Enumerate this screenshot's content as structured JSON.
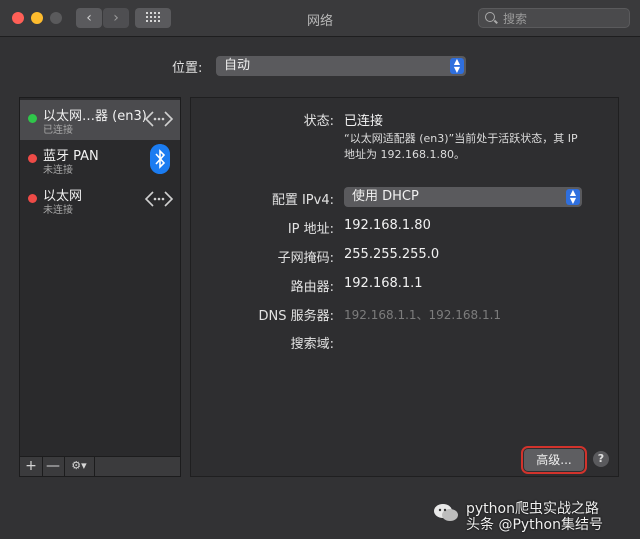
{
  "window": {
    "title": "网络",
    "search_placeholder": "搜索"
  },
  "location": {
    "label": "位置:",
    "value": "自动"
  },
  "services": [
    {
      "name": "以太网…器 (en3)",
      "status": "已连接",
      "state_color": "#2fc64a",
      "icon": "ethernet-arrows-icon"
    },
    {
      "name": "蓝牙 PAN",
      "status": "未连接",
      "state_color": "#ee4b47",
      "icon": "bluetooth-icon"
    },
    {
      "name": "以太网",
      "status": "未连接",
      "state_color": "#ee4b47",
      "icon": "ethernet-arrows-icon"
    }
  ],
  "sidebar_controls": {
    "add": "+",
    "remove": "—",
    "action": "⚙▾"
  },
  "details": {
    "status_label": "状态:",
    "status_value": "已连接",
    "status_desc": "“以太网适配器 (en3)”当前处于活跃状态，其 IP 地址为 192.168.1.80。",
    "ipv4_label": "配置 IPv4:",
    "ipv4_value": "使用 DHCP",
    "ip_label": "IP 地址:",
    "ip_value": "192.168.1.80",
    "mask_label": "子网掩码:",
    "mask_value": "255.255.255.0",
    "router_label": "路由器:",
    "router_value": "192.168.1.1",
    "dns_label": "DNS 服务器:",
    "dns_value": "192.168.1.1、192.168.1.1",
    "search_domain_label": "搜索域:"
  },
  "buttons": {
    "advanced": "高级...",
    "help": "?"
  },
  "watermark": {
    "line1": "python爬虫实战之路",
    "line2": "头条 @Python集结号"
  },
  "colors": {
    "accent": "#2f6fde",
    "highlight_border": "#d2332c",
    "connected": "#2fc64a",
    "disconnected": "#ee4b47"
  }
}
